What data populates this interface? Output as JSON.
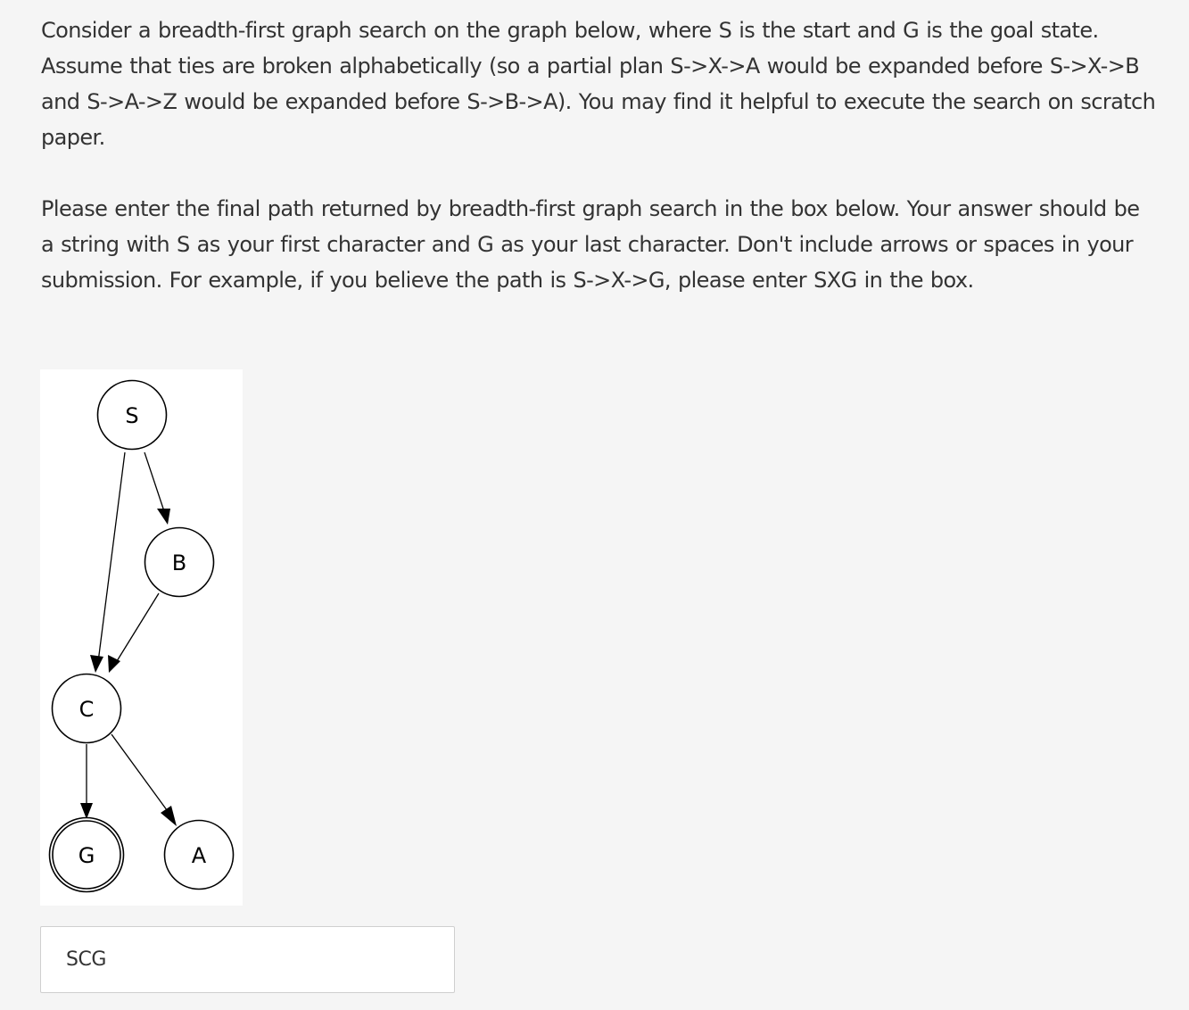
{
  "question": {
    "paragraph_1": "Consider a breadth-first graph search on the graph below, where S is the start and G is the goal state. Assume that ties are broken alphabetically (so a partial plan S->X->A would be expanded before S->X->B and S->A->Z would be expanded before S->B->A). You may find it helpful to execute the search on scratch paper.",
    "paragraph_2": "Please enter the final path returned by breadth-first graph search in the box below. Your answer should be a string with S as your first character and G as your last character. Don't include arrows or spaces in your submission. For example, if you believe the path is S->X->G, please enter SXG in the box."
  },
  "graph": {
    "nodes": {
      "S": "S",
      "B": "B",
      "C": "C",
      "G": "G",
      "A": "A"
    },
    "edges": [
      {
        "from": "S",
        "to": "B"
      },
      {
        "from": "S",
        "to": "C"
      },
      {
        "from": "B",
        "to": "C"
      },
      {
        "from": "C",
        "to": "G"
      },
      {
        "from": "C",
        "to": "A"
      }
    ]
  },
  "answer": {
    "value": "SCG"
  }
}
